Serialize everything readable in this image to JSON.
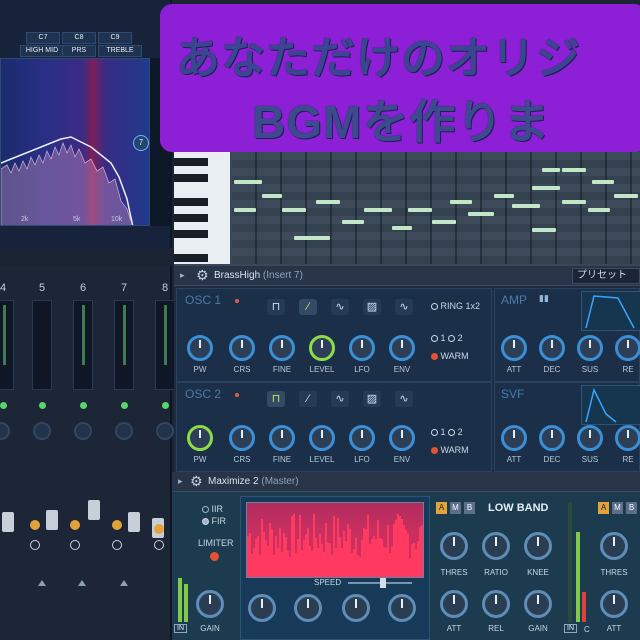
{
  "title_overlay": {
    "line1": "あなただけのオリジ",
    "line2": "BGMを作りま"
  },
  "eq": {
    "bands": [
      "C7",
      "C8",
      "C9"
    ],
    "band_labels": [
      "HIGH MID",
      "PRS",
      "TREBLE"
    ],
    "freq_labels": [
      "2k",
      "5k",
      "10k"
    ],
    "band_number": "7"
  },
  "mixer": {
    "channel_numbers": [
      "4",
      "5",
      "6",
      "7",
      "8"
    ]
  },
  "synth": {
    "header_arrow": "▸",
    "plugin_name": "BrassHigh",
    "insert_label": "(Insert 7)",
    "preset_label": "プリセット",
    "osc1_title": "OSC 1",
    "osc2_title": "OSC 2",
    "amp_title": "AMP",
    "svf_title": "SVF",
    "ring_label": "RING 1x2",
    "warm_label": "WARM",
    "sel_1": "1",
    "sel_2": "2",
    "osc1_knobs": [
      "PW",
      "CRS",
      "FINE",
      "LEVEL",
      "LFO",
      "ENV"
    ],
    "osc2_knobs": [
      "PW",
      "CRS",
      "FINE",
      "LEVEL",
      "LFO",
      "ENV"
    ],
    "amp_knobs": [
      "ATT",
      "DEC",
      "SUS",
      "RE"
    ],
    "svf_knobs": [
      "ATT",
      "DEC",
      "SUS",
      "RE"
    ],
    "waveforms": [
      "⊓",
      "∕",
      "∿",
      "▨",
      "∿"
    ]
  },
  "maximize": {
    "plugin_name": "Maximize 2",
    "insert_label": "(Master)",
    "iir": "IIR",
    "fir": "FIR",
    "limiter": "LIMITER",
    "in_label": "IN",
    "gain_label": "GAIN",
    "speed_label": "SPEED",
    "low_band": "LOW BAND",
    "ab_buttons": [
      "A",
      "M",
      "B"
    ],
    "row1_knobs": [
      "THRES",
      "RATIO",
      "KNEE"
    ],
    "row2_knobs": [
      "ATT",
      "REL",
      "GAIN"
    ],
    "right_row1": "THRES",
    "right_row2": "ATT",
    "c_label": "C"
  },
  "colors": {
    "title_bg": "#8d1fd6",
    "note": "#c3e6c8",
    "accent_blue": "#3b8fd6",
    "accent_green": "#8fdc4a",
    "limiter_red": "#ff3960"
  }
}
